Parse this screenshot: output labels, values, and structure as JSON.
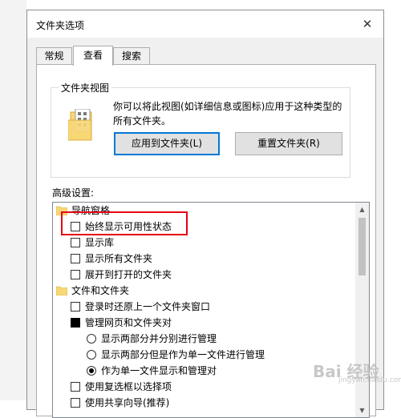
{
  "window": {
    "title": "文件夹选项",
    "close_glyph": "✕"
  },
  "tabs": [
    {
      "label": "常规",
      "active": false
    },
    {
      "label": "查看",
      "active": true
    },
    {
      "label": "搜索",
      "active": false
    }
  ],
  "folder_views": {
    "title": "文件夹视图",
    "description": "你可以将此视图(如详细信息或图标)应用于这种类型的所有文件夹。",
    "apply_button": "应用到文件夹(L)",
    "reset_button": "重置文件夹(R)"
  },
  "advanced": {
    "label": "高级设置:",
    "items": [
      {
        "kind": "folder",
        "label": "导航窗格"
      },
      {
        "kind": "checkbox",
        "label": "始终显示可用性状态",
        "checked": false
      },
      {
        "kind": "checkbox",
        "label": "显示库",
        "checked": false
      },
      {
        "kind": "checkbox",
        "label": "显示所有文件夹",
        "checked": false
      },
      {
        "kind": "checkbox",
        "label": "展开到打开的文件夹",
        "checked": false
      },
      {
        "kind": "folder",
        "label": "文件和文件夹"
      },
      {
        "kind": "checkbox",
        "label": "登录时还原上一个文件夹窗口",
        "checked": false
      },
      {
        "kind": "checkbox-filled",
        "label": "管理网页和文件夹对"
      },
      {
        "kind": "radio",
        "label": "显示两部分并分别进行管理",
        "selected": false
      },
      {
        "kind": "radio",
        "label": "显示两部分但是作为单一文件进行管理",
        "selected": false
      },
      {
        "kind": "radio",
        "label": "作为单一文件显示和管理对",
        "selected": true
      },
      {
        "kind": "checkbox",
        "label": "使用复选框以选择项",
        "checked": false
      },
      {
        "kind": "checkbox",
        "label": "使用共享向导(推荐)",
        "checked": false
      }
    ]
  },
  "scrollbar": {
    "up_glyph": "▲",
    "down_glyph": "▼"
  },
  "watermark": {
    "main": "Bai 经验",
    "sub": "jingyan.baidu.com"
  },
  "colors": {
    "accent": "#0078d7",
    "highlight": "#e60012",
    "folder": "#f8d775"
  }
}
